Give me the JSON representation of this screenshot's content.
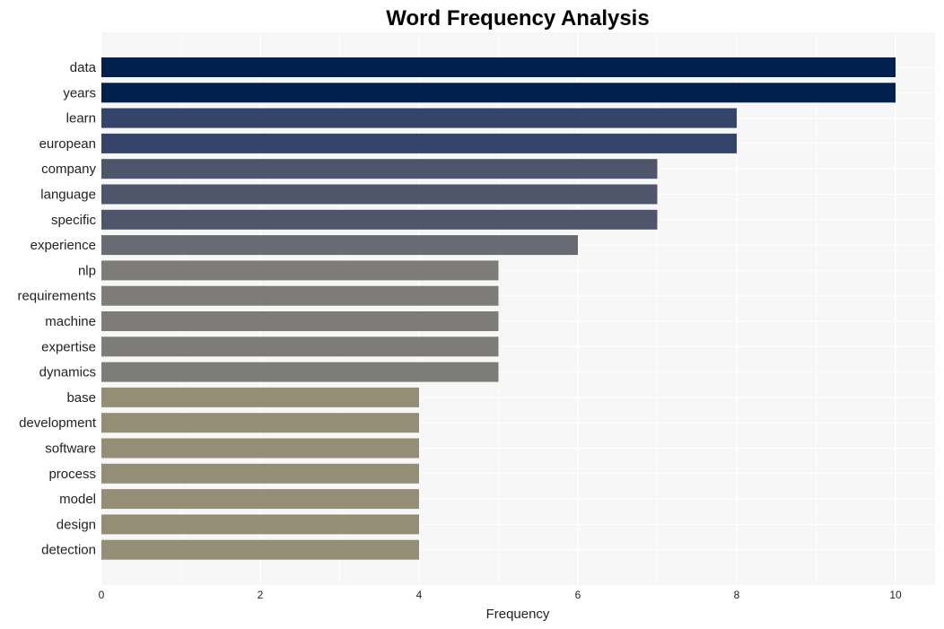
{
  "chart_data": {
    "type": "bar",
    "orientation": "horizontal",
    "title": "Word Frequency Analysis",
    "xlabel": "Frequency",
    "ylabel": "",
    "xlim": [
      0,
      10.5
    ],
    "xticks": [
      0,
      2,
      4,
      6,
      8,
      10
    ],
    "grid": true,
    "legend": "none",
    "categories": [
      "data",
      "years",
      "learn",
      "european",
      "company",
      "language",
      "specific",
      "experience",
      "nlp",
      "requirements",
      "machine",
      "expertise",
      "dynamics",
      "base",
      "development",
      "software",
      "process",
      "model",
      "design",
      "detection"
    ],
    "values": [
      10,
      10,
      8,
      8,
      7,
      7,
      7,
      6,
      5,
      5,
      5,
      5,
      5,
      4,
      4,
      4,
      4,
      4,
      4,
      4
    ],
    "colors": {
      "10": "#00204e",
      "8": "#35446a",
      "7": "#4f566b",
      "6": "#696b72",
      "5": "#7d7c78",
      "4": "#958e77"
    }
  }
}
